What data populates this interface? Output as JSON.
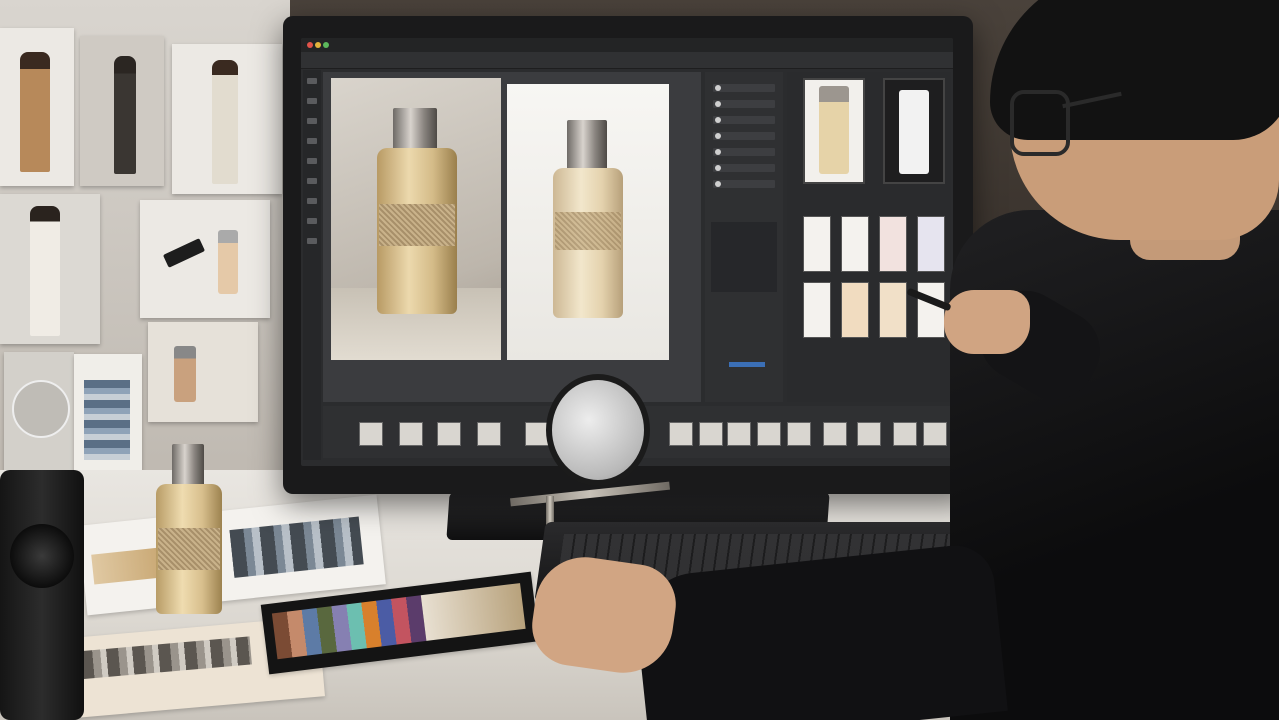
{
  "scene": {
    "description_tag": "",
    "colors": {
      "wall": "#4a423b",
      "desk": "#e9e6e1",
      "monitor_bezel": "#1a1a1b",
      "screen_bg": "#2b2c2e",
      "perfume_liquid": "#e7d5a8",
      "cap_metal": "#a6a09a",
      "shirt": "#161618"
    }
  },
  "monitor": {
    "app": {
      "icons": [
        "move-icon",
        "lasso-icon",
        "crop-icon",
        "brush-icon",
        "clone-icon",
        "eraser-icon",
        "gradient-icon",
        "text-icon",
        "zoom-icon"
      ],
      "layers_count": 7,
      "swatch_grid": {
        "rows": 2,
        "cols": 4
      },
      "filmstrip_count": 16
    }
  }
}
